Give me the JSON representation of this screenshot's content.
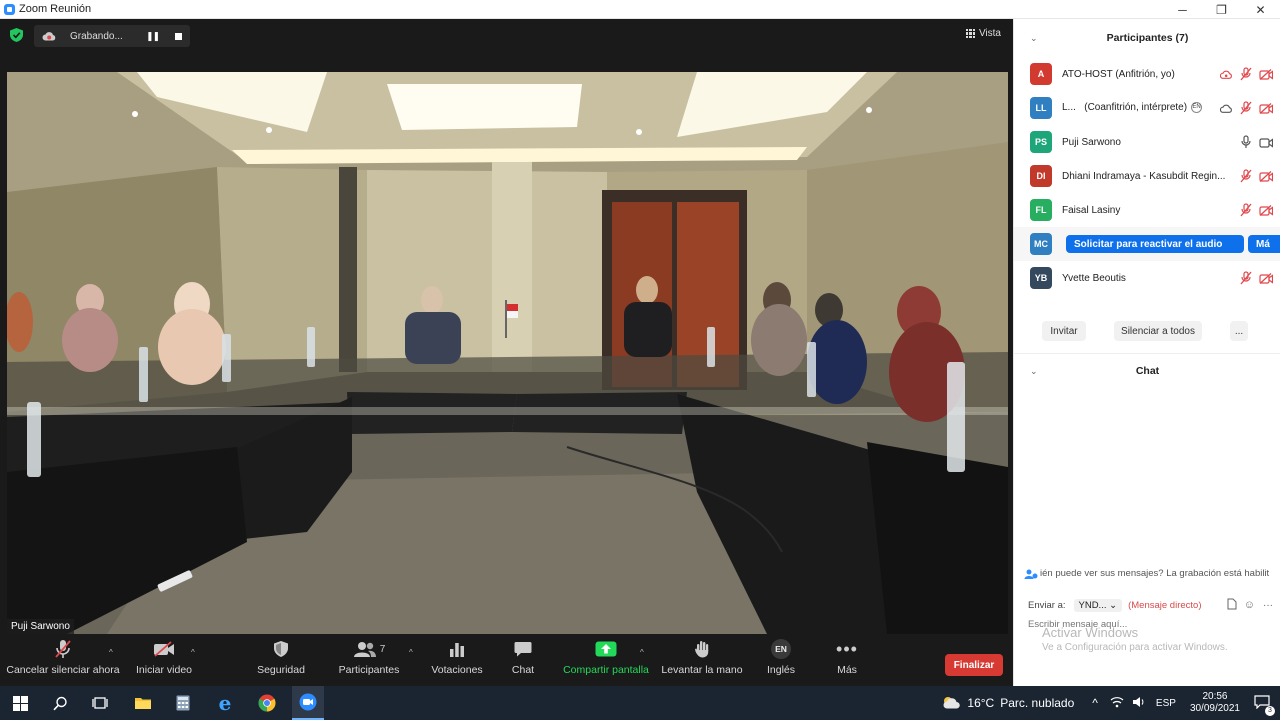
{
  "window": {
    "title": "Zoom Reunión",
    "minimize": "─",
    "maximize": "❐",
    "close": "✕"
  },
  "meeting": {
    "recording_label": "Grabando...",
    "view_label": "Vista",
    "speaker_name": "Puji Sarwono"
  },
  "toolbar": {
    "mute": "Cancelar silenciar ahora",
    "video": "Iniciar video",
    "security": "Seguridad",
    "participants": "Participantes",
    "participants_count": "7",
    "polls": "Votaciones",
    "chat": "Chat",
    "share": "Compartir pantalla",
    "raise_hand": "Levantar la mano",
    "language": "Inglés",
    "language_badge": "EN",
    "more": "Más",
    "end": "Finalizar"
  },
  "panel": {
    "participants_title": "Participantes (7)",
    "participants": [
      {
        "initials": "A",
        "name": "ATO-HOST (Anfitrión, yo)",
        "color": "#d2392f"
      },
      {
        "initials": "LL",
        "name": "L...",
        "role": "(Coanfitrión, intérprete)",
        "badge": "EN",
        "color": "#2f7fc1"
      },
      {
        "initials": "PS",
        "name": "Puji Sarwono",
        "color": "#1fa57a"
      },
      {
        "initials": "DI",
        "name": "Dhiani Indramaya - Kasubdit Regin...",
        "color": "#c0392b"
      },
      {
        "initials": "FL",
        "name": "Faisal Lasiny",
        "color": "#27ae60"
      },
      {
        "initials": "MC",
        "name": "",
        "color": "#2f7fc1"
      },
      {
        "initials": "YB",
        "name": "Yvette Beoutis",
        "color": "#34495e"
      }
    ],
    "ask_unmute": "Solicitar para reactivar el audio",
    "more_short": "Má",
    "invite": "Invitar",
    "mute_all": "Silenciar a todos",
    "ellipsis": "...",
    "chat_title": "Chat",
    "chat_notice": "ién puede ver sus mensajes? La grabación está habilit",
    "send_to": "Enviar a:",
    "recipient": "YND...",
    "direct": "(Mensaje directo)",
    "input_placeholder": "Escribir mensaje aquí...",
    "activate_title": "Activar Windows",
    "activate_sub": "Ve a Configuración para activar Windows."
  },
  "taskbar": {
    "temperature": "16°C",
    "weather": "Parc. nublado",
    "lang": "ESP",
    "time": "20:56",
    "date": "30/09/2021",
    "notif_count": "3"
  },
  "colors": {
    "accent": "#0e71eb",
    "end": "#d63a32",
    "share": "#23d959",
    "taskbar": "#1b2431"
  }
}
